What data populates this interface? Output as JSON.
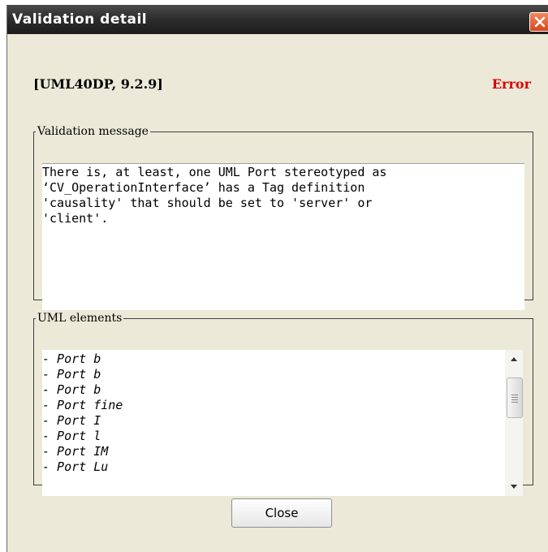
{
  "window": {
    "title": "Validation detail"
  },
  "rule": {
    "code": "[UML40DP, 9.2.9]",
    "severity": "Error",
    "severity_color": "#dd0000"
  },
  "message_group": {
    "legend": "Validation message",
    "lines": [
      "There is, at least, one UML Port stereotyped as",
      "‘CV_OperationInterface’ has a Tag definition",
      "'causality' that should be set to 'server' or",
      "'client'."
    ]
  },
  "elements_group": {
    "legend": "UML elements",
    "items": [
      "- Port b",
      "- Port b",
      "- Port b",
      "- Port fine",
      "- Port I",
      "- Port l",
      "- Port IM",
      "- Port Lu"
    ]
  },
  "buttons": {
    "close_label": "Close"
  },
  "icons": {
    "close": "close-icon",
    "scroll_up": "chevron-up-icon",
    "scroll_down": "chevron-down-icon"
  }
}
